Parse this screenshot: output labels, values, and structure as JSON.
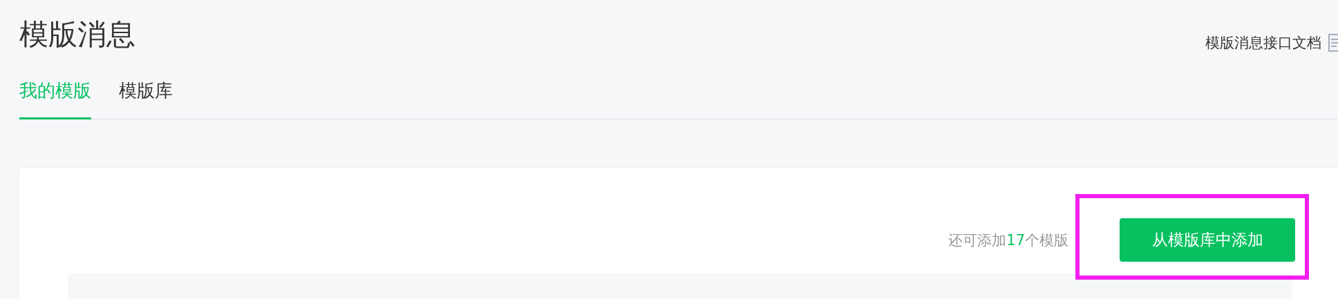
{
  "page": {
    "title": "模版消息",
    "doc_link": "模版消息接口文档"
  },
  "tabs": [
    {
      "label": "我的模版",
      "selected": true
    },
    {
      "label": "模版库",
      "selected": false
    }
  ],
  "card": {
    "hint": "还可添加**17**个模版",
    "add_button": "从模版库中添加"
  }
}
